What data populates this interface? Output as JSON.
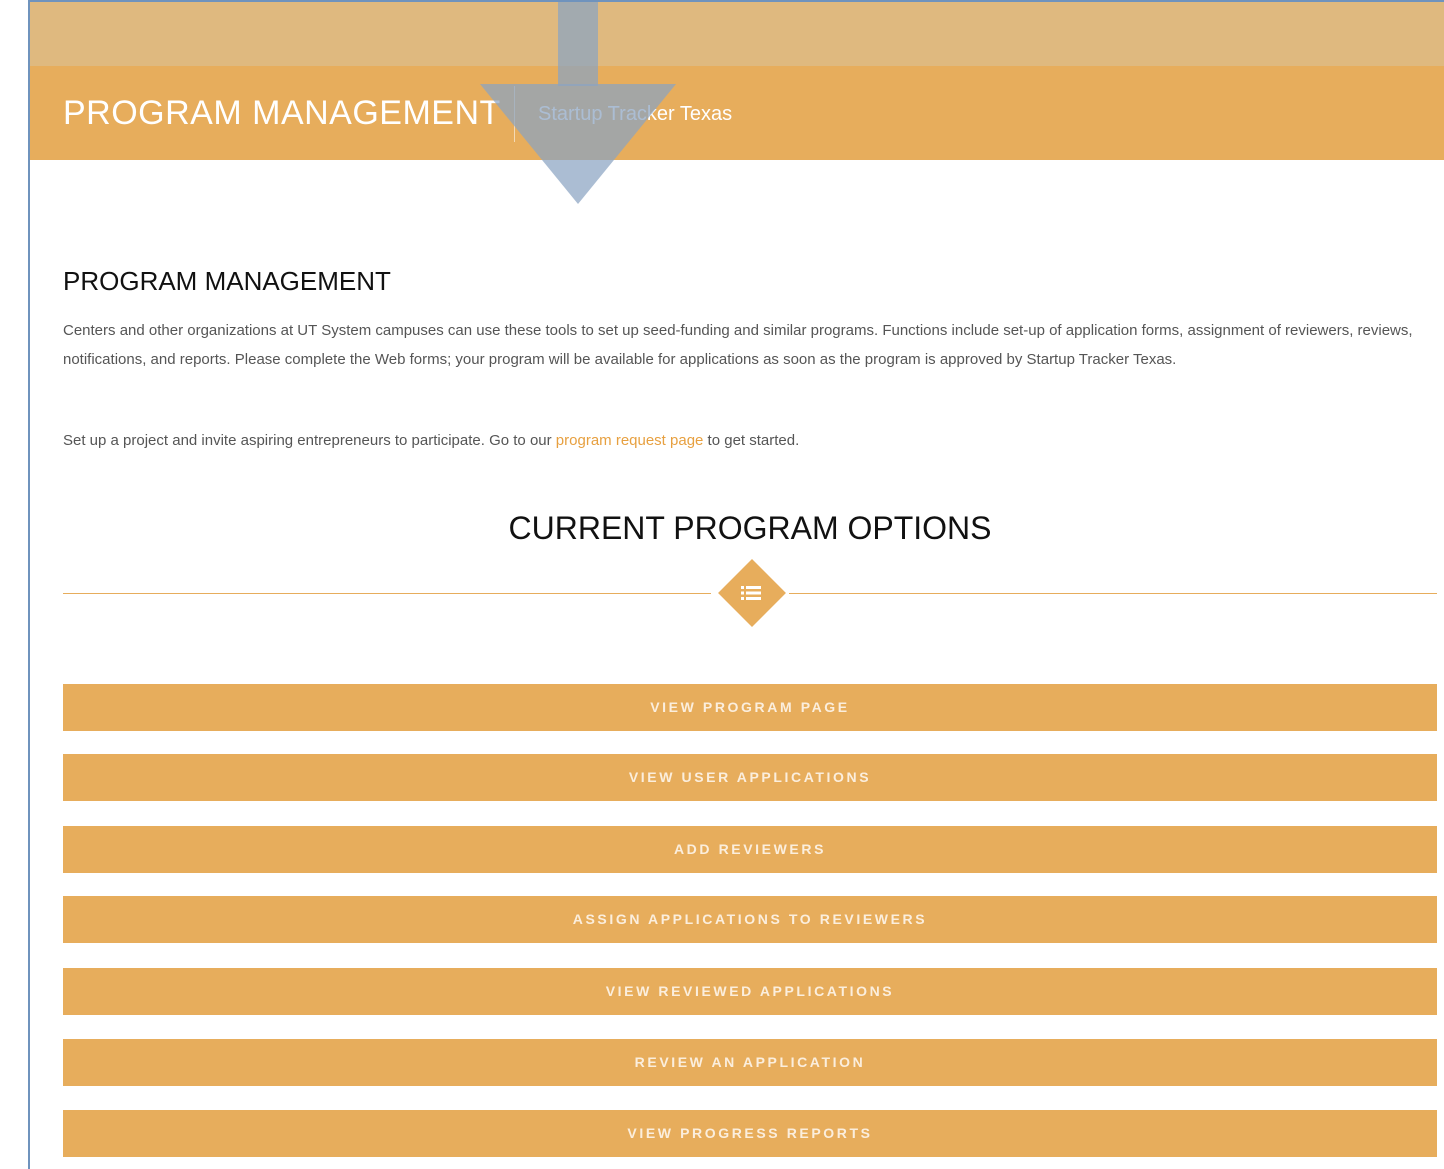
{
  "header": {
    "title": "PROGRAM MANAGEMENT",
    "subtitle": "Startup Tracker Texas"
  },
  "intro": {
    "heading": "PROGRAM MANAGEMENT",
    "paragraph": "Centers and other organizations at UT System campuses can use these tools to set up seed-funding and similar programs. Functions include set-up of application forms, assignment of reviewers, reviews, notifications, and reports. Please complete the Web forms; your program will be available for applications as soon as the program is approved by Startup Tracker Texas.",
    "cta_before": "Set up a project and invite aspiring entrepreneurs to participate. Go to our ",
    "cta_link": "program request page",
    "cta_after": " to get started."
  },
  "options": {
    "heading": "CURRENT PROGRAM OPTIONS",
    "divider_icon": "list-icon",
    "buttons": [
      "VIEW PROGRAM PAGE",
      "VIEW USER APPLICATIONS",
      "ADD REVIEWERS",
      "ASSIGN APPLICATIONS TO REVIEWERS",
      "VIEW REVIEWED APPLICATIONS",
      "REVIEW AN APPLICATION",
      "VIEW PROGRESS REPORTS"
    ]
  },
  "colors": {
    "accent": "#e7ad5c",
    "top_strip": "#dfb97f",
    "link": "#e7a040",
    "overlay_arrow": "#8aa3c2"
  },
  "annotation": {
    "icon": "down-arrow-icon"
  }
}
